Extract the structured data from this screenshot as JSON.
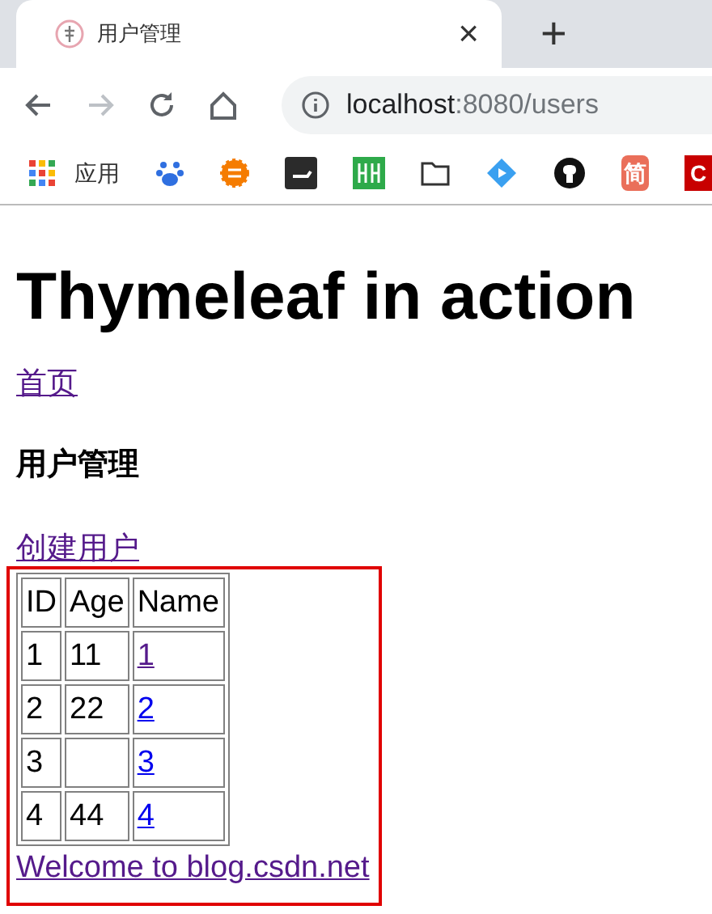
{
  "tab": {
    "title": "用户管理",
    "close": "×",
    "new_tab": "+"
  },
  "address_bar": {
    "host": "localhost",
    "path": ":8080/users"
  },
  "bookmarks": [
    {
      "kind": "apps",
      "label": "应用"
    },
    {
      "kind": "paw"
    },
    {
      "kind": "sun"
    },
    {
      "kind": "terminal"
    },
    {
      "kind": "bars"
    },
    {
      "kind": "folder"
    },
    {
      "kind": "diamond"
    },
    {
      "kind": "cat"
    },
    {
      "kind": "jian",
      "label": "简"
    },
    {
      "kind": "c",
      "label": "C"
    }
  ],
  "page": {
    "heading": "Thymeleaf in action",
    "home_link": {
      "text": "首页",
      "visited": true
    },
    "section_title": "用户管理",
    "create_link": {
      "text": "创建用户",
      "visited": true
    },
    "table": {
      "columns": [
        "ID",
        "Age",
        "Name"
      ],
      "rows": [
        {
          "id": "1",
          "age": "11",
          "name": "1",
          "visited": true
        },
        {
          "id": "2",
          "age": "22",
          "name": "2",
          "visited": false
        },
        {
          "id": "3",
          "age": "",
          "name": "3",
          "visited": false
        },
        {
          "id": "4",
          "age": "44",
          "name": "4",
          "visited": false
        }
      ]
    },
    "footer_link": {
      "text": "Welcome to blog.csdn.net",
      "visited": true
    }
  },
  "annotation": {
    "kind": "highlight-rectangle",
    "color": "#e00000"
  }
}
